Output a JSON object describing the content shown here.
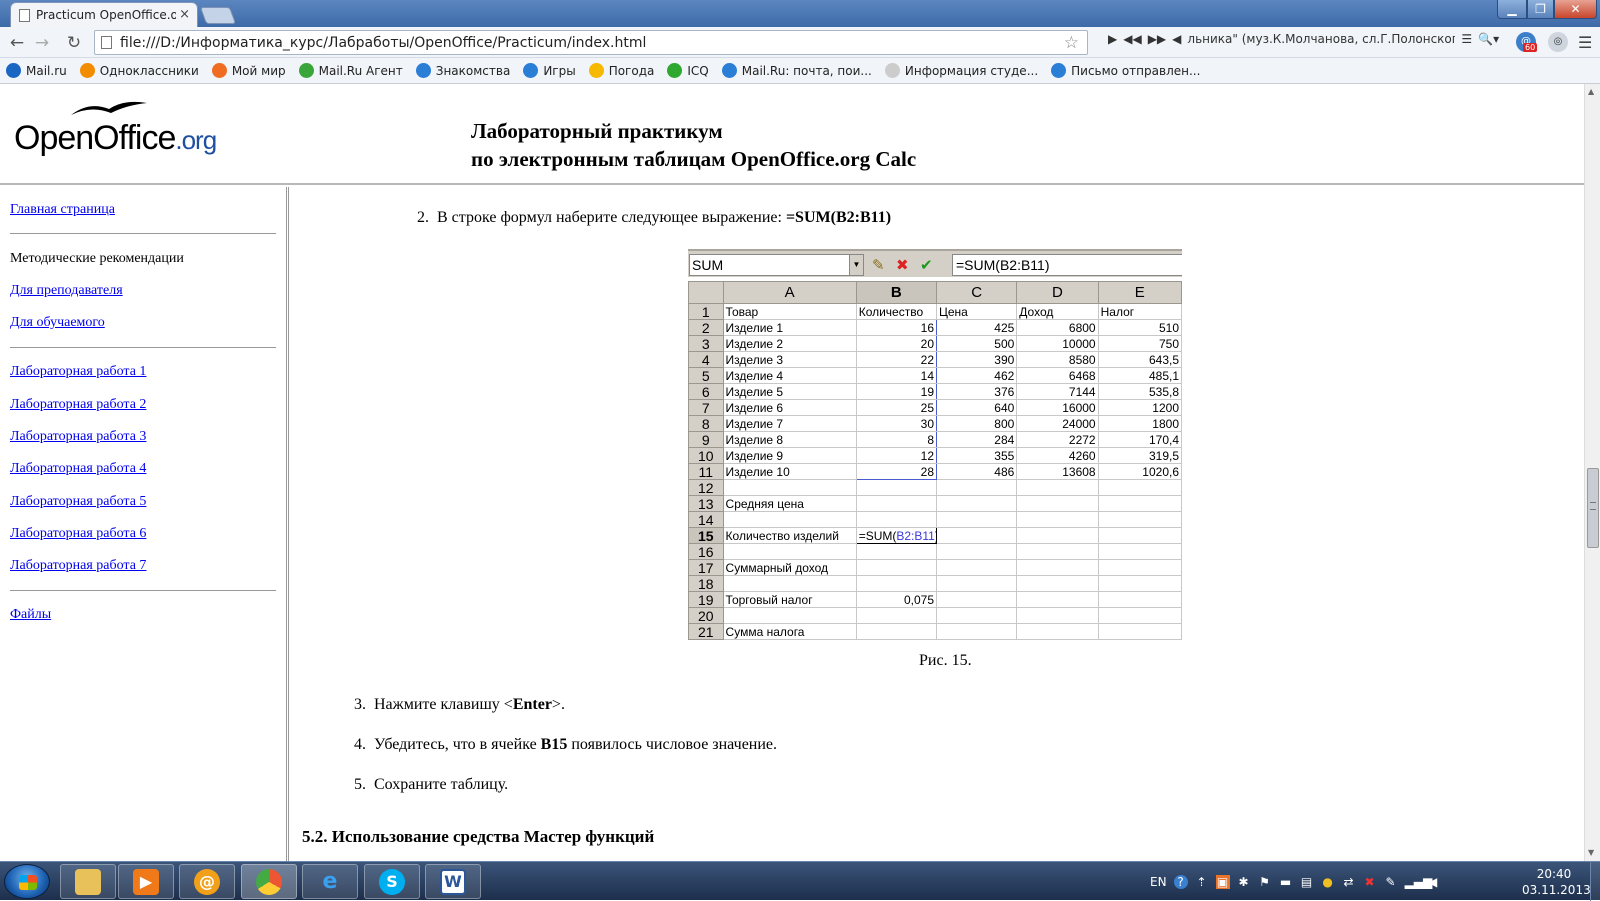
{
  "browser": {
    "tab_title": "Practicum OpenOffice.org",
    "tab_close": "×",
    "url": "file:///D:/Информатика_курс/Лабработы/OpenOffice/Practicum/index.html",
    "media_text": "льника\" (муз.К.Молчанова, сл.Г.Полонского)",
    "ext_badge": "60",
    "bookmarks": [
      {
        "label": "Mail.ru",
        "color": "#1a66c2"
      },
      {
        "label": "Одноклассники",
        "color": "#f28c00"
      },
      {
        "label": "Мой мир",
        "color": "#ef6c22"
      },
      {
        "label": "Mail.Ru Агент",
        "color": "#3aa63a"
      },
      {
        "label": "Знакомства",
        "color": "#2b7ed6"
      },
      {
        "label": "Игры",
        "color": "#2b7ed6"
      },
      {
        "label": "Погода",
        "color": "#f6b800"
      },
      {
        "label": "ICQ",
        "color": "#2ea82e"
      },
      {
        "label": "Mail.Ru: почта, пои...",
        "color": "#2b7ed6"
      },
      {
        "label": "Информация студе...",
        "color": "#cccccc"
      },
      {
        "label": "Письмо отправлен...",
        "color": "#2b7ed6"
      }
    ]
  },
  "page": {
    "logo_main": "OpenOffice",
    "logo_suffix": ".org",
    "title_line1": "Лабораторный практикум",
    "title_line2": "по электронным таблицам OpenOffice.org Calc"
  },
  "sidebar": {
    "home": "Главная страница",
    "methodical": "Методические рекомендации",
    "for_teacher": "Для преподавателя",
    "for_student": "Для обучаемого",
    "labs": [
      "Лабораторная работа 1",
      "Лабораторная работа 2",
      "Лабораторная работа 3",
      "Лабораторная работа 4",
      "Лабораторная работа 5",
      "Лабораторная работа 6",
      "Лабораторная работа 7"
    ],
    "files": "Файлы"
  },
  "content": {
    "step2_num": "2.",
    "step2_text": "В строке формул наберите следующее выражение: ",
    "step2_bold": "=SUM(B2:B11)",
    "caption": "Рис. 15.",
    "step3_num": "3.",
    "step3_pre": "Нажмите клавишу <",
    "step3_bold": "Enter",
    "step3_post": ">.",
    "step4_num": "4.",
    "step4_pre": "Убедитесь, что в ячейке ",
    "step4_bold": "B15",
    "step4_post": " появилось числовое значение.",
    "step5_num": "5.",
    "step5_text": "Сохраните таблицу.",
    "section_heading": "5.2. Использование средства Мастер функций"
  },
  "spreadsheet": {
    "name_box": "SUM",
    "formula": "=SUM(B2:B11)",
    "columns": [
      "A",
      "B",
      "C",
      "D",
      "E"
    ],
    "rows": [
      {
        "n": "1",
        "a": "Товар",
        "b": "Количество",
        "c": "Цена",
        "d": "Доход",
        "e": "Налог"
      },
      {
        "n": "2",
        "a": "Изделие 1",
        "b": "16",
        "c": "425",
        "d": "6800",
        "e": "510"
      },
      {
        "n": "3",
        "a": "Изделие 2",
        "b": "20",
        "c": "500",
        "d": "10000",
        "e": "750"
      },
      {
        "n": "4",
        "a": "Изделие 3",
        "b": "22",
        "c": "390",
        "d": "8580",
        "e": "643,5"
      },
      {
        "n": "5",
        "a": "Изделие 4",
        "b": "14",
        "c": "462",
        "d": "6468",
        "e": "485,1"
      },
      {
        "n": "6",
        "a": "Изделие 5",
        "b": "19",
        "c": "376",
        "d": "7144",
        "e": "535,8"
      },
      {
        "n": "7",
        "a": "Изделие 6",
        "b": "25",
        "c": "640",
        "d": "16000",
        "e": "1200"
      },
      {
        "n": "8",
        "a": "Изделие 7",
        "b": "30",
        "c": "800",
        "d": "24000",
        "e": "1800"
      },
      {
        "n": "9",
        "a": "Изделие 8",
        "b": "8",
        "c": "284",
        "d": "2272",
        "e": "170,4"
      },
      {
        "n": "10",
        "a": "Изделие 9",
        "b": "12",
        "c": "355",
        "d": "4260",
        "e": "319,5"
      },
      {
        "n": "11",
        "a": "Изделие 10",
        "b": "28",
        "c": "486",
        "d": "13608",
        "e": "1020,6"
      },
      {
        "n": "12",
        "a": "",
        "b": "",
        "c": "",
        "d": "",
        "e": ""
      },
      {
        "n": "13",
        "a": "Средняя цена",
        "b": "",
        "c": "",
        "d": "",
        "e": ""
      },
      {
        "n": "14",
        "a": "",
        "b": "",
        "c": "",
        "d": "",
        "e": ""
      },
      {
        "n": "15",
        "a": "Количество изделий",
        "b": "",
        "c": "",
        "d": "",
        "e": ""
      },
      {
        "n": "16",
        "a": "",
        "b": "",
        "c": "",
        "d": "",
        "e": ""
      },
      {
        "n": "17",
        "a": "Суммарный доход",
        "b": "",
        "c": "",
        "d": "",
        "e": ""
      },
      {
        "n": "18",
        "a": "",
        "b": "",
        "c": "",
        "d": "",
        "e": ""
      },
      {
        "n": "19",
        "a": "Торговый налог",
        "b": "0,075",
        "c": "",
        "d": "",
        "e": ""
      },
      {
        "n": "20",
        "a": "",
        "b": "",
        "c": "",
        "d": "",
        "e": ""
      },
      {
        "n": "21",
        "a": "Сумма налога",
        "b": "",
        "c": "",
        "d": "",
        "e": ""
      }
    ],
    "b15_prefix": "=SUM(",
    "b15_ref": "B2:B11",
    "b15_suffix": ")"
  },
  "taskbar": {
    "lang": "EN",
    "time": "20:40",
    "date": "03.11.2013"
  }
}
